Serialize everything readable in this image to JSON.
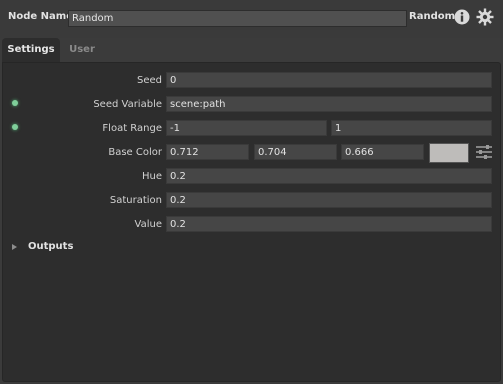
{
  "header": {
    "node_name_label": "Node Name",
    "node_name_value": "Random",
    "node_type": "Random",
    "info_icon": "info-icon",
    "gear_icon": "gear-icon"
  },
  "tabs": [
    {
      "label": "Settings",
      "active": true
    },
    {
      "label": "User",
      "active": false
    }
  ],
  "params": {
    "seed": {
      "label": "Seed",
      "value": "0"
    },
    "seed_variable": {
      "label": "Seed Variable",
      "value": "scene:path"
    },
    "float_range": {
      "label": "Float Range",
      "min": "-1",
      "max": "1"
    },
    "base_color": {
      "label": "Base Color",
      "r": "0.712",
      "g": "0.704",
      "b": "0.666",
      "swatch": "#bebcba"
    },
    "hue": {
      "label": "Hue",
      "value": "0.2"
    },
    "saturation": {
      "label": "Saturation",
      "value": "0.2"
    },
    "value": {
      "label": "Value",
      "value": "0.2"
    }
  },
  "outputs": {
    "label": "Outputs"
  },
  "colors": {
    "background": "#3b3b3b",
    "panel": "#2d2d2d",
    "field": "#464646",
    "connection_dot": "#7fcf9a"
  }
}
